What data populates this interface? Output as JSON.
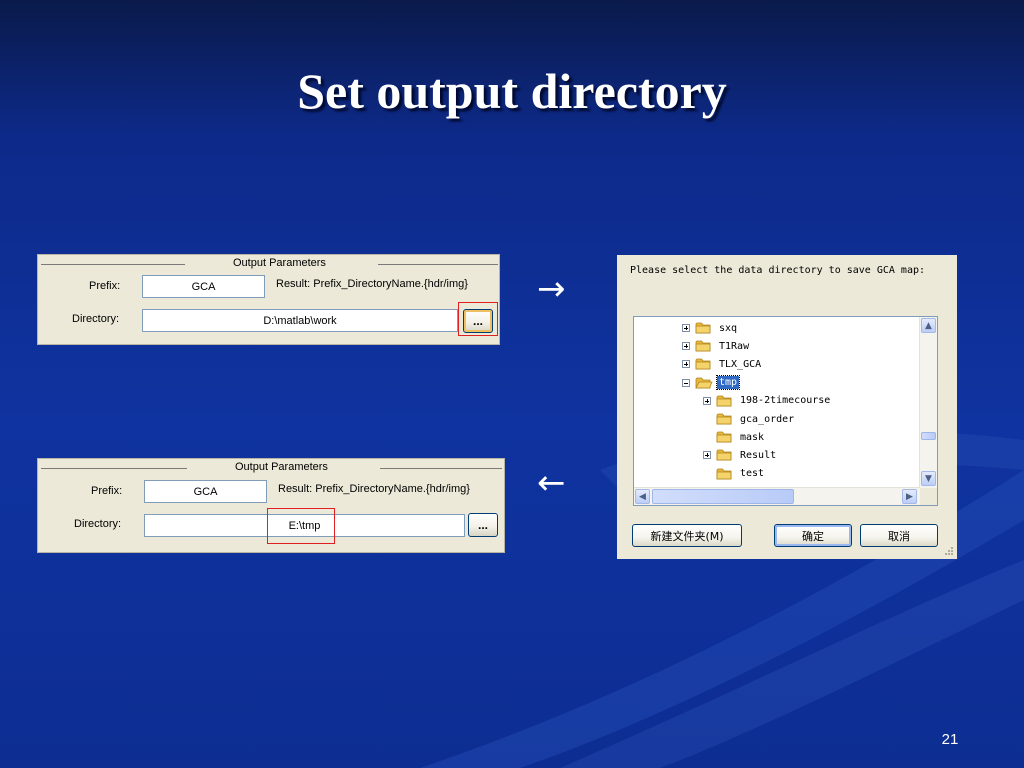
{
  "slide": {
    "title": "Set output directory",
    "page_number": "21",
    "arrow_right": "→",
    "arrow_left": "←"
  },
  "panel_top": {
    "group_title": "Output Parameters",
    "prefix_label": "Prefix:",
    "prefix_value": "GCA",
    "result_text": "Result: Prefix_DirectoryName.{hdr/img}",
    "directory_label": "Directory:",
    "directory_value": "D:\\matlab\\work",
    "browse_label": "..."
  },
  "panel_bottom": {
    "group_title": "Output Parameters",
    "prefix_label": "Prefix:",
    "prefix_value": "GCA",
    "result_text": "Result: Prefix_DirectoryName.{hdr/img}",
    "directory_label": "Directory:",
    "directory_value": "E:\\tmp",
    "browse_label": "..."
  },
  "dialog": {
    "prompt": "Please select the data directory to save GCA map:",
    "tree": [
      {
        "label": "sxq",
        "expander": "plus",
        "level": 0,
        "selected": false
      },
      {
        "label": "T1Raw",
        "expander": "plus",
        "level": 0,
        "selected": false
      },
      {
        "label": "TLX_GCA",
        "expander": "plus",
        "level": 0,
        "selected": false
      },
      {
        "label": "tmp",
        "expander": "minus",
        "level": 0,
        "selected": true,
        "open": true
      },
      {
        "label": "198-2timecourse",
        "expander": "plus",
        "level": 1,
        "selected": false
      },
      {
        "label": "gca_order",
        "expander": "none",
        "level": 1,
        "selected": false
      },
      {
        "label": "mask",
        "expander": "none",
        "level": 1,
        "selected": false
      },
      {
        "label": "Result",
        "expander": "plus",
        "level": 1,
        "selected": false
      },
      {
        "label": "test",
        "expander": "none",
        "level": 1,
        "selected": false
      }
    ],
    "new_folder_button": "新建文件夹(M)",
    "ok_button": "确定",
    "cancel_button": "取消"
  },
  "colors": {
    "background": "#0f33a0",
    "highlight_box": "#e02020",
    "selection": "#316ac5",
    "folder": "#f5d36b"
  }
}
